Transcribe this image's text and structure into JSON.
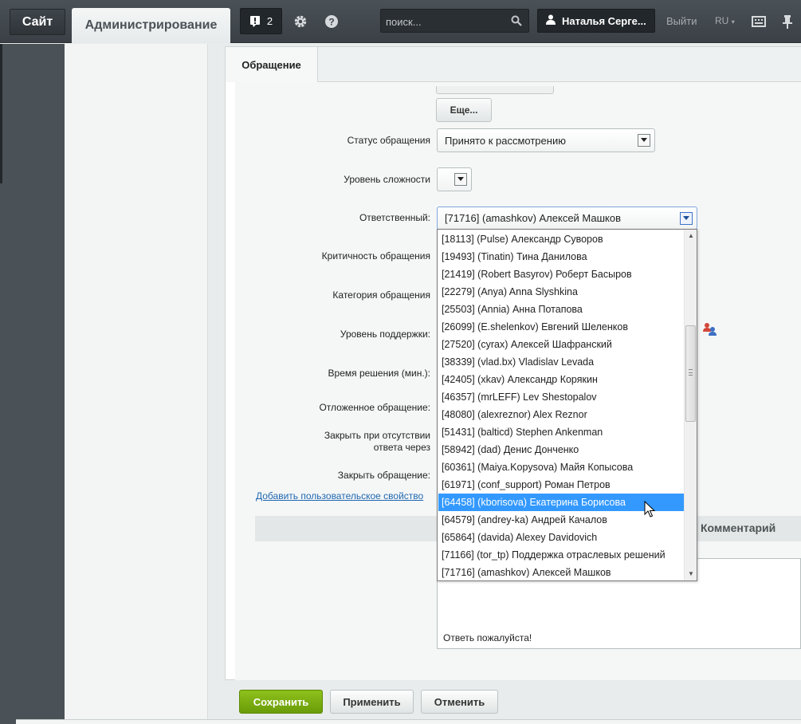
{
  "topbar": {
    "site_label": "Сайт",
    "admin_label": "Администрирование",
    "notify_count": "2",
    "search_placeholder": "поиск...",
    "user_name": "Наталья Серге...",
    "logout_label": "Выйти",
    "lang_label": "RU"
  },
  "tabs": {
    "active": "Обращение"
  },
  "form": {
    "more_button": "Еще...",
    "status_label": "Статус обращения",
    "status_value": "Принято к рассмотрению",
    "difficulty_label": "Уровень сложности",
    "responsible_label": "Ответственный:",
    "responsible_value": "[71716] (amashkov) Алексей Машков",
    "criticality_label": "Критичность обращения",
    "category_label": "Категория обращения",
    "support_level_label": "Уровень поддержки:",
    "solve_time_label": "Время решения (мин.):",
    "deferred_label": "Отложенное обращение:",
    "autoclose_label_1": "Закрыть при отсутствии",
    "autoclose_label_2": "ответа через",
    "close_label": "Закрыть обращение:",
    "add_property_link": "Добавить пользовательское свойство",
    "comment_header": "Комментарий",
    "comment_text": "Ответь пожалуйста!"
  },
  "dropdown": {
    "items": [
      "[18113] (Pulse) Александр Суворов",
      "[19493] (Tinatin) Тина Данилова",
      "[21419] (Robert Basyrov) Роберт Басыров",
      "[22279] (Anya) Anna Slyshkina",
      "[25503] (Annia) Анна Потапова",
      "[26099] (E.shelenkov) Евгений Шеленков",
      "[27520] (cyrax) Алексей Шафранский",
      "[38339] (vlad.bx) Vladislav Levada",
      "[42405] (xkav) Александр Корякин",
      "[46357] (mrLEFF) Lev Shestopalov",
      "[48080] (alexreznor) Alex Reznor",
      "[51431] (balticd) Stephen Ankenman",
      "[58942] (dad) Денис Донченко",
      "[60361] (Maiya.Kopysova) Майя Копысова",
      "[61971] (conf_support) Роман Петров",
      "[64458] (kborisova) Екатерина Борисова",
      "[64579] (andrey-ka) Андрей Качалов",
      "[65864] (davida) Alexey Davidovich",
      "[71166] (tor_tp) Поддержка отраслевых решений",
      "[71716] (amashkov) Алексей Машков"
    ]
  },
  "buttons": {
    "save": "Сохранить",
    "apply": "Применить",
    "cancel": "Отменить"
  }
}
